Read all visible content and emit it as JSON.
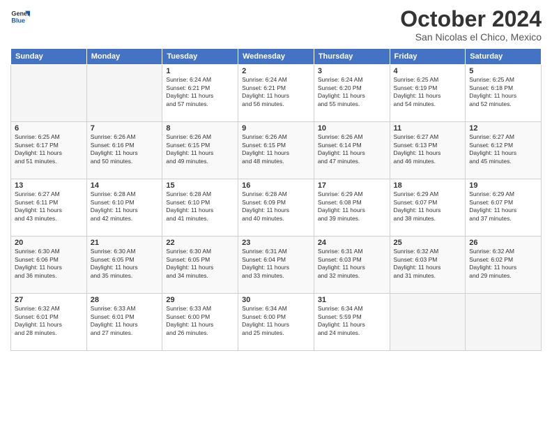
{
  "logo": {
    "line1": "General",
    "line2": "Blue"
  },
  "header": {
    "month": "October 2024",
    "location": "San Nicolas el Chico, Mexico"
  },
  "days_of_week": [
    "Sunday",
    "Monday",
    "Tuesday",
    "Wednesday",
    "Thursday",
    "Friday",
    "Saturday"
  ],
  "weeks": [
    [
      {
        "day": "",
        "info": ""
      },
      {
        "day": "",
        "info": ""
      },
      {
        "day": "1",
        "info": "Sunrise: 6:24 AM\nSunset: 6:21 PM\nDaylight: 11 hours\nand 57 minutes."
      },
      {
        "day": "2",
        "info": "Sunrise: 6:24 AM\nSunset: 6:21 PM\nDaylight: 11 hours\nand 56 minutes."
      },
      {
        "day": "3",
        "info": "Sunrise: 6:24 AM\nSunset: 6:20 PM\nDaylight: 11 hours\nand 55 minutes."
      },
      {
        "day": "4",
        "info": "Sunrise: 6:25 AM\nSunset: 6:19 PM\nDaylight: 11 hours\nand 54 minutes."
      },
      {
        "day": "5",
        "info": "Sunrise: 6:25 AM\nSunset: 6:18 PM\nDaylight: 11 hours\nand 52 minutes."
      }
    ],
    [
      {
        "day": "6",
        "info": "Sunrise: 6:25 AM\nSunset: 6:17 PM\nDaylight: 11 hours\nand 51 minutes."
      },
      {
        "day": "7",
        "info": "Sunrise: 6:26 AM\nSunset: 6:16 PM\nDaylight: 11 hours\nand 50 minutes."
      },
      {
        "day": "8",
        "info": "Sunrise: 6:26 AM\nSunset: 6:15 PM\nDaylight: 11 hours\nand 49 minutes."
      },
      {
        "day": "9",
        "info": "Sunrise: 6:26 AM\nSunset: 6:15 PM\nDaylight: 11 hours\nand 48 minutes."
      },
      {
        "day": "10",
        "info": "Sunrise: 6:26 AM\nSunset: 6:14 PM\nDaylight: 11 hours\nand 47 minutes."
      },
      {
        "day": "11",
        "info": "Sunrise: 6:27 AM\nSunset: 6:13 PM\nDaylight: 11 hours\nand 46 minutes."
      },
      {
        "day": "12",
        "info": "Sunrise: 6:27 AM\nSunset: 6:12 PM\nDaylight: 11 hours\nand 45 minutes."
      }
    ],
    [
      {
        "day": "13",
        "info": "Sunrise: 6:27 AM\nSunset: 6:11 PM\nDaylight: 11 hours\nand 43 minutes."
      },
      {
        "day": "14",
        "info": "Sunrise: 6:28 AM\nSunset: 6:10 PM\nDaylight: 11 hours\nand 42 minutes."
      },
      {
        "day": "15",
        "info": "Sunrise: 6:28 AM\nSunset: 6:10 PM\nDaylight: 11 hours\nand 41 minutes."
      },
      {
        "day": "16",
        "info": "Sunrise: 6:28 AM\nSunset: 6:09 PM\nDaylight: 11 hours\nand 40 minutes."
      },
      {
        "day": "17",
        "info": "Sunrise: 6:29 AM\nSunset: 6:08 PM\nDaylight: 11 hours\nand 39 minutes."
      },
      {
        "day": "18",
        "info": "Sunrise: 6:29 AM\nSunset: 6:07 PM\nDaylight: 11 hours\nand 38 minutes."
      },
      {
        "day": "19",
        "info": "Sunrise: 6:29 AM\nSunset: 6:07 PM\nDaylight: 11 hours\nand 37 minutes."
      }
    ],
    [
      {
        "day": "20",
        "info": "Sunrise: 6:30 AM\nSunset: 6:06 PM\nDaylight: 11 hours\nand 36 minutes."
      },
      {
        "day": "21",
        "info": "Sunrise: 6:30 AM\nSunset: 6:05 PM\nDaylight: 11 hours\nand 35 minutes."
      },
      {
        "day": "22",
        "info": "Sunrise: 6:30 AM\nSunset: 6:05 PM\nDaylight: 11 hours\nand 34 minutes."
      },
      {
        "day": "23",
        "info": "Sunrise: 6:31 AM\nSunset: 6:04 PM\nDaylight: 11 hours\nand 33 minutes."
      },
      {
        "day": "24",
        "info": "Sunrise: 6:31 AM\nSunset: 6:03 PM\nDaylight: 11 hours\nand 32 minutes."
      },
      {
        "day": "25",
        "info": "Sunrise: 6:32 AM\nSunset: 6:03 PM\nDaylight: 11 hours\nand 31 minutes."
      },
      {
        "day": "26",
        "info": "Sunrise: 6:32 AM\nSunset: 6:02 PM\nDaylight: 11 hours\nand 29 minutes."
      }
    ],
    [
      {
        "day": "27",
        "info": "Sunrise: 6:32 AM\nSunset: 6:01 PM\nDaylight: 11 hours\nand 28 minutes."
      },
      {
        "day": "28",
        "info": "Sunrise: 6:33 AM\nSunset: 6:01 PM\nDaylight: 11 hours\nand 27 minutes."
      },
      {
        "day": "29",
        "info": "Sunrise: 6:33 AM\nSunset: 6:00 PM\nDaylight: 11 hours\nand 26 minutes."
      },
      {
        "day": "30",
        "info": "Sunrise: 6:34 AM\nSunset: 6:00 PM\nDaylight: 11 hours\nand 25 minutes."
      },
      {
        "day": "31",
        "info": "Sunrise: 6:34 AM\nSunset: 5:59 PM\nDaylight: 11 hours\nand 24 minutes."
      },
      {
        "day": "",
        "info": ""
      },
      {
        "day": "",
        "info": ""
      }
    ]
  ]
}
